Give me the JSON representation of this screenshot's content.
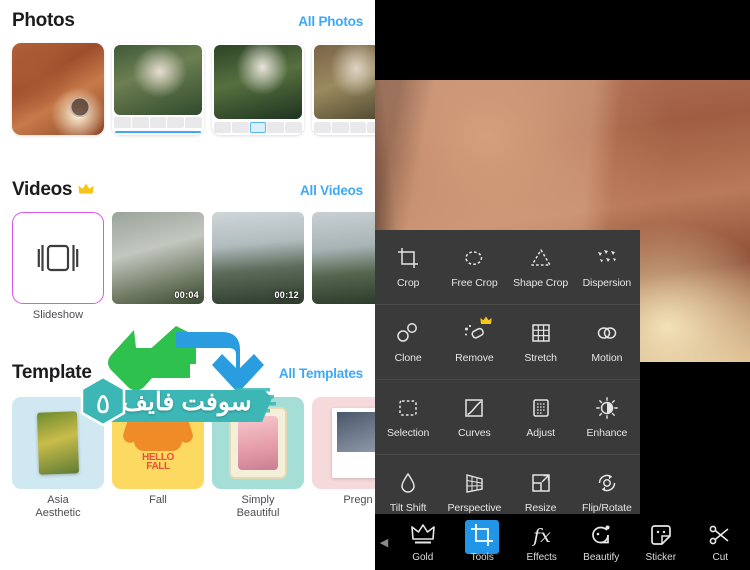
{
  "left": {
    "photos": {
      "title": "Photos",
      "link": "All Photos",
      "items": [
        {
          "name": "photo-1"
        },
        {
          "name": "photo-2"
        },
        {
          "name": "photo-3"
        },
        {
          "name": "photo-4"
        }
      ]
    },
    "videos": {
      "title": "Videos",
      "crown": "♛",
      "link": "All Videos",
      "slideshow_label": "Slideshow",
      "items": [
        {
          "duration": "00:04"
        },
        {
          "duration": "00:12"
        },
        {
          "duration": ""
        }
      ]
    },
    "templates": {
      "title": "Template",
      "link": "All Templates",
      "items": [
        {
          "label": "Asia\nAesthetic"
        },
        {
          "label": "Fall"
        },
        {
          "label": "Simply\nBeautiful"
        },
        {
          "label": "Pregn"
        }
      ],
      "fall_text_1": "HELLO",
      "fall_text_2": "FALL"
    },
    "watermark": {
      "text": "سوفت فايف",
      "logo_char": "٥",
      "teal": "#3cb7b5",
      "green_arrow": "#2fc14d",
      "blue_arrow": "#2a9de0"
    }
  },
  "right": {
    "tools": [
      [
        {
          "label": "Crop",
          "icon": "crop-icon",
          "pro": false
        },
        {
          "label": "Free Crop",
          "icon": "free-crop-icon",
          "pro": false
        },
        {
          "label": "Shape Crop",
          "icon": "shape-crop-icon",
          "pro": false
        },
        {
          "label": "Dispersion",
          "icon": "dispersion-icon",
          "pro": false
        }
      ],
      [
        {
          "label": "Clone",
          "icon": "clone-icon",
          "pro": false
        },
        {
          "label": "Remove",
          "icon": "remove-icon",
          "pro": true,
          "pro_badge": "♛"
        },
        {
          "label": "Stretch",
          "icon": "stretch-icon",
          "pro": false
        },
        {
          "label": "Motion",
          "icon": "motion-icon",
          "pro": false
        }
      ],
      [
        {
          "label": "Selection",
          "icon": "selection-icon",
          "pro": false
        },
        {
          "label": "Curves",
          "icon": "curves-icon",
          "pro": false
        },
        {
          "label": "Adjust",
          "icon": "adjust-icon",
          "pro": false
        },
        {
          "label": "Enhance",
          "icon": "enhance-icon",
          "pro": false
        }
      ],
      [
        {
          "label": "Tilt Shift",
          "icon": "tilt-shift-icon",
          "pro": false
        },
        {
          "label": "Perspective",
          "icon": "perspective-icon",
          "pro": false
        },
        {
          "label": "Resize",
          "icon": "resize-icon",
          "pro": false
        },
        {
          "label": "Flip/Rotate",
          "icon": "flip-rotate-icon",
          "pro": false
        }
      ]
    ],
    "nav": {
      "scroll_left": "◀",
      "items": [
        {
          "label": "Gold",
          "icon": "crown-icon",
          "active": false
        },
        {
          "label": "Tools",
          "icon": "crop-icon",
          "active": true
        },
        {
          "label": "Effects",
          "icon": "fx-icon",
          "active": false
        },
        {
          "label": "Beautify",
          "icon": "face-icon",
          "active": false
        },
        {
          "label": "Sticker",
          "icon": "sticker-icon",
          "active": false
        },
        {
          "label": "Cut",
          "icon": "scissors-icon",
          "active": false
        }
      ],
      "active_color": "#2196e8"
    }
  }
}
